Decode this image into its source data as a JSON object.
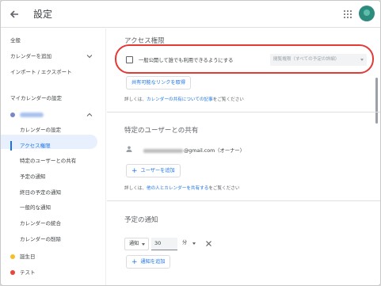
{
  "header": {
    "title": "設定"
  },
  "sidebar": {
    "general": "全般",
    "add_calendar": "カレンダーを追加",
    "import_export": "インポート / エクスポート",
    "my_calendars_settings": "マイカレンダーの設定",
    "sub_items": [
      "カレンダーの設定",
      "アクセス権限",
      "特定のユーザーとの共有",
      "予定の通知",
      "終日の予定の通知",
      "一般的な通知",
      "カレンダーの統合",
      "カレンダーの削除"
    ],
    "other_calendars": [
      {
        "label": "誕生日",
        "color": "#f6bf26"
      },
      {
        "label": "テスト",
        "color": "#e8453c"
      }
    ],
    "selected_calendar_color": "#7986cb"
  },
  "access": {
    "title": "アクセス権限",
    "public_checkbox_label": "一般公開して誰でも利用できるようにする",
    "permission_select": "閲覧権限（すべての予定の詳細）",
    "share_link_button": "共有可能なリンクを取得",
    "help_prefix": "詳しくは、",
    "help_link": "カレンダーの共有についての記事",
    "help_suffix": "をご覧ください"
  },
  "share": {
    "title": "特定のユーザーとの共有",
    "email_suffix": "@gmail.com（オーナー）",
    "add_user_button": "ユーザーを追加",
    "help_prefix": "詳しくは、",
    "help_link": "他の人とカレンダーを共有する",
    "help_suffix": "をご覧ください"
  },
  "notifications": {
    "title": "予定の通知",
    "type": "通知",
    "value": "30",
    "unit": "分",
    "add_button": "通知を追加"
  },
  "colors": {
    "accent": "#1a73e8",
    "highlight_oval": "#e53935"
  }
}
